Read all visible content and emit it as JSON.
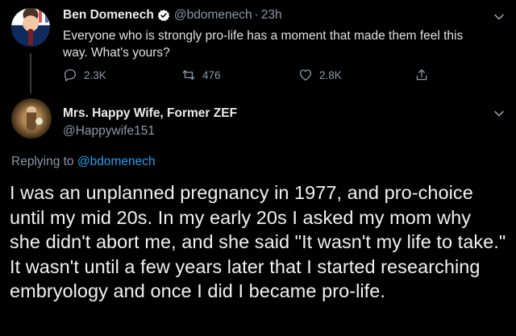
{
  "colors": {
    "background": "#000000",
    "primary_text": "#e1e1e1",
    "secondary_text": "#8b98a5",
    "link": "#1da1f2",
    "verified_badge": "#ffffff"
  },
  "tweet": {
    "author": {
      "display_name": "Ben Domenech",
      "handle": "@bdomenech",
      "verified": true,
      "avatar_icon": "profile-photo-man-in-suit"
    },
    "separator": "·",
    "time": "23h",
    "text": "Everyone who is strongly pro-life has a moment that made them feel this way. What's yours?",
    "actions": {
      "reply_count": "2.3K",
      "retweet_count": "476",
      "like_count": "2.8K"
    },
    "icons": {
      "reply": "reply-icon",
      "retweet": "retweet-icon",
      "like": "heart-icon",
      "share": "share-icon",
      "more": "chevron-down-icon"
    }
  },
  "reply": {
    "author": {
      "display_name": "Mrs. Happy Wife, Former ZEF",
      "handle": "@Happywife151",
      "avatar_icon": "profile-photo-basketball-player"
    },
    "replying_to_prefix": "Replying to",
    "replying_to_handle": "@bdomenech",
    "text": "I was an unplanned pregnancy in 1977, and pro-choice until my mid 20s. In my early 20s I asked my mom why she didn't abort me, and she said \"It wasn't my life to take.\" It wasn't until a few years later that I started researching embryology and once I did I became pro-life."
  }
}
